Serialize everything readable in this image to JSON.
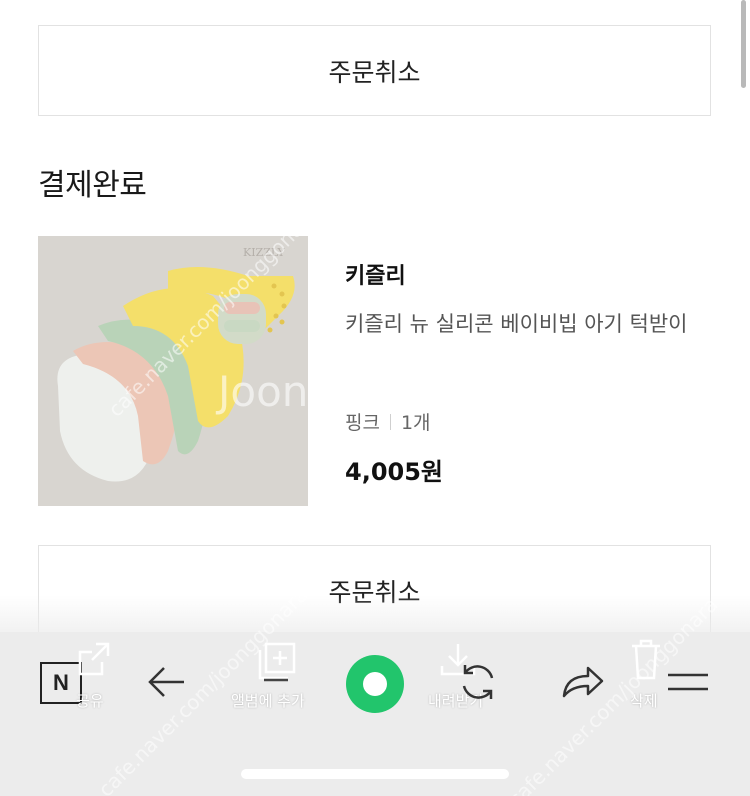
{
  "order": {
    "cancel_label_top": "주문취소",
    "section_title": "결제완료",
    "cancel_label_bottom": "주문취소"
  },
  "product": {
    "brand": "키즐리",
    "name": "키즐리 뉴 실리콘 베이비빕 아기 턱받이",
    "option_color": "핑크",
    "option_qty": "1개",
    "price": "4,005원",
    "image_brand_text": "KIZZLY"
  },
  "toolbar": {
    "share_label": "공유",
    "add_album_label": "앨범에 추가",
    "download_label": "내려받기",
    "delete_label": "삭제"
  },
  "watermark": {
    "text": "cafe.naver.com/joonggonara",
    "logo": "Joon"
  },
  "colors": {
    "accent_green": "#22c56c",
    "toolbar_bg": "#ececec",
    "border": "#e2e2e2"
  },
  "icons": [
    "n-logo-icon",
    "share-icon",
    "back-arrow-icon",
    "add-album-icon",
    "download-icon",
    "refresh-icon",
    "forward-icon",
    "trash-icon",
    "menu-icon"
  ]
}
